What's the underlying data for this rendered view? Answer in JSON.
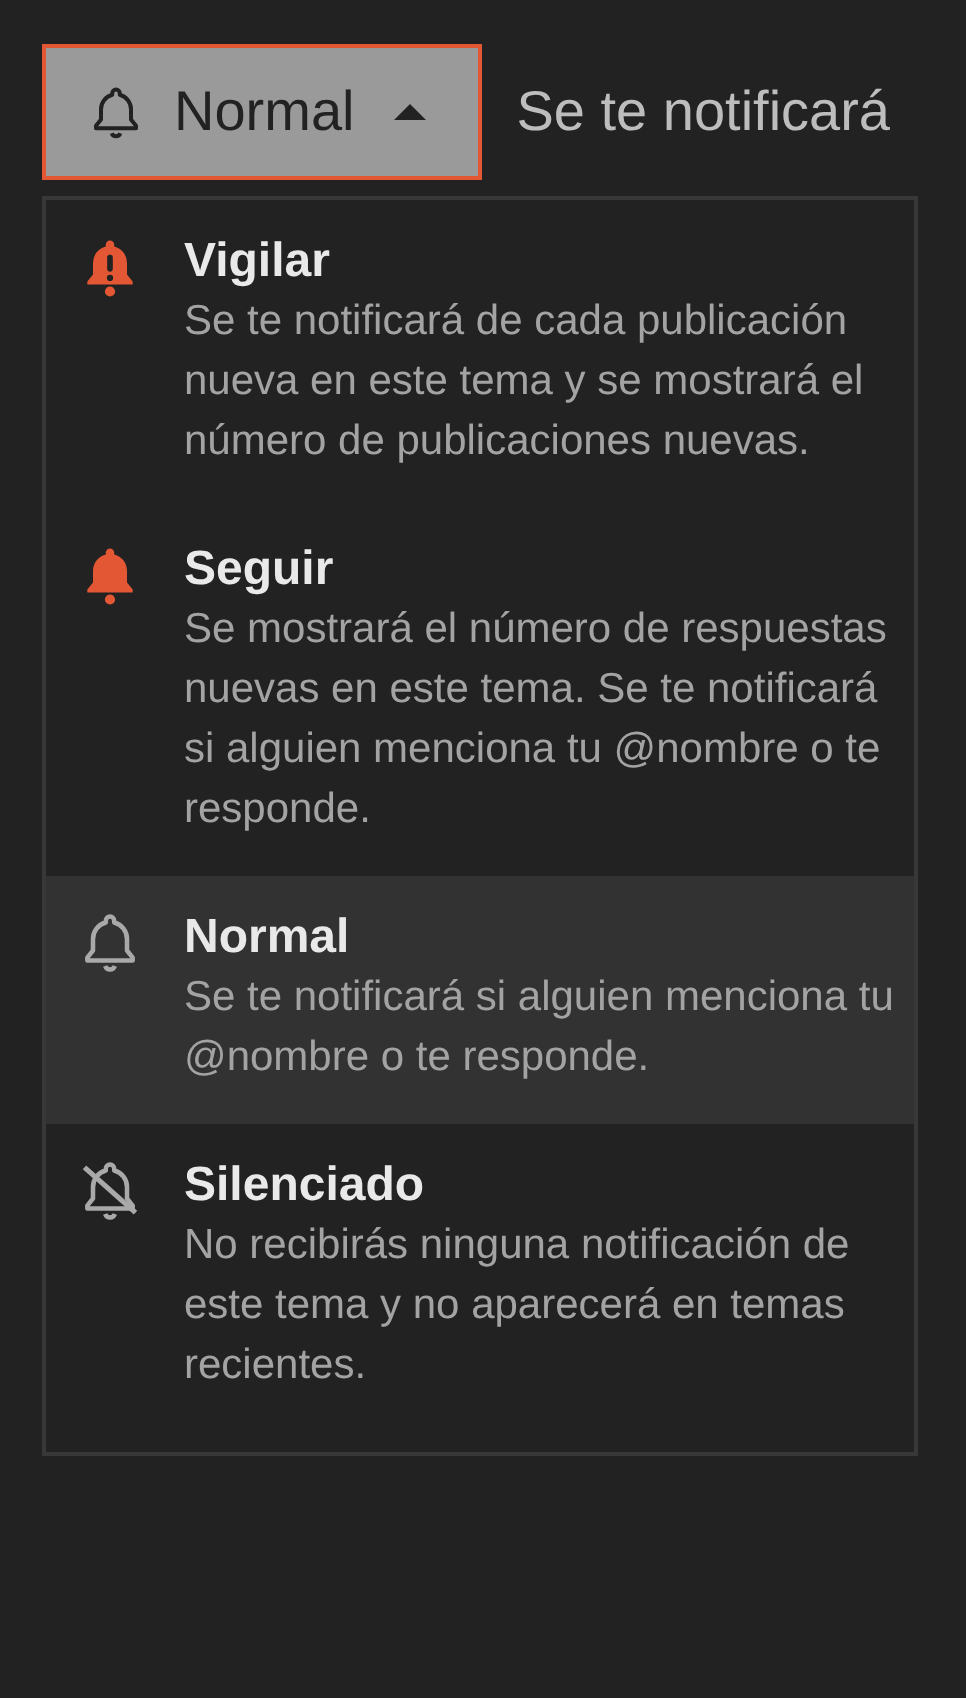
{
  "dropdown_button": {
    "label": "Normal",
    "kind": "regular",
    "expanded": true
  },
  "description": "Se te notificará",
  "menu_items": [
    {
      "kind": "watching",
      "title": "Vigilar",
      "description": "Se te notificará de cada publicación nueva en este tema y se mostrará el número de publicaciones nuevas.",
      "selected": false
    },
    {
      "kind": "tracking",
      "title": "Seguir",
      "description": "Se mostrará el número de respuestas nuevas en este tema. Se te notificará si alguien menciona tu @nombre o te responde.",
      "selected": false
    },
    {
      "kind": "regular",
      "title": "Normal",
      "description": "Se te notificará si alguien menciona tu @nombre o te responde.",
      "selected": true
    },
    {
      "kind": "muted",
      "title": "Silenciado",
      "description": "No recibirás ninguna notificación de este tema y no aparecerá en temas recientes.",
      "selected": false
    }
  ]
}
